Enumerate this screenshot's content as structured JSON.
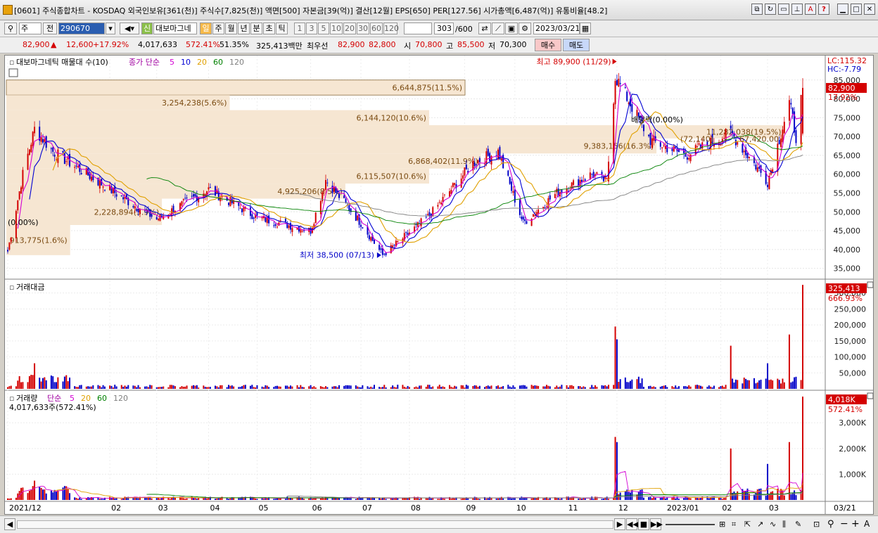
{
  "window": {
    "title": "[0601] 주식종합차트 - KOSDAQ 외국인보유[361(천)] 주식수[7,825(천)] 액면[500] 자본금[39(억)] 결산[12월] EPS[650] PER[127.56] 시가총액[6,487(억)] 유통비율[48.2]",
    "icons": [
      "app-icon",
      "window-link-icon",
      "refresh-icon",
      "window-layout-icon",
      "pin-icon",
      "pen-icon",
      "help-icon",
      "minimize-icon",
      "restore-icon",
      "close-icon"
    ],
    "help_label": "?"
  },
  "toolbar": {
    "period_type": "주",
    "prev_label": "전",
    "stock_code": "290670",
    "indicator_select": "대보마그네",
    "period_buttons": [
      "일",
      "주",
      "월",
      "년",
      "분",
      "초",
      "틱"
    ],
    "active_period": "일",
    "interval_buttons": [
      "1",
      "3",
      "5",
      "10",
      "20",
      "30",
      "60",
      "120"
    ],
    "view_count": "303",
    "view_total": "/600",
    "date": "2023/03/21",
    "new_label": "신"
  },
  "quote": {
    "price": "82,900",
    "change_arrow": "▲",
    "change": "12,600",
    "change_pct": "+17.92%",
    "volume": "4,017,633",
    "volume_pct": "572.41%",
    "ratio": "51.35%",
    "amount": "325,413백만",
    "best_ask_label": "최우선",
    "ask": "82,900",
    "bid": "82,800",
    "open_label": "시",
    "open": "70,800",
    "high_label": "고",
    "high": "85,500",
    "low_label": "저",
    "low": "70,300",
    "buy_label": "매수",
    "sell_label": "매도",
    "colors": {
      "up": "#d40000",
      "down": "#0000c8",
      "buy_bg": "#f9c8c8",
      "sell_bg": "#c8d8f9"
    }
  },
  "price_panel": {
    "legend_title": "대보마그네틱 매물대 수(10)",
    "ma_label": "종가 단순",
    "ma_periods": [
      "5",
      "10",
      "20",
      "60",
      "120"
    ],
    "ma_colors": [
      "#d400d4",
      "#0000d4",
      "#e0a000",
      "#008000",
      "#808080"
    ],
    "lc_label": "LC:115.32",
    "hc_label": "HC:-7.79",
    "last_price_box": "82,900",
    "last_change_label": "17.92%",
    "high_note": "최고 89,900 (11/29)",
    "low_note": "최저 38,500 (07/13)",
    "dividend_note": "배당락(0.00%)",
    "left_note": "(0.00%)",
    "volume_profile": [
      {
        "label": "6,644,875(11.5%)",
        "top": 85000,
        "bottom": 81000,
        "pct": 11.5
      },
      {
        "label": "3,254,238(5.6%)",
        "top": 81000,
        "bottom": 77000,
        "pct": 5.6
      },
      {
        "label": "6,144,120(10.6%)",
        "top": 77000,
        "bottom": 73000,
        "pct": 10.6
      },
      {
        "label": "11,282,038(19.5%)",
        "top": 73000,
        "bottom": 69500,
        "pct": 19.5
      },
      {
        "label": "9,383,156(16.3%)",
        "top": 69500,
        "bottom": 65500,
        "pct": 16.3
      },
      {
        "label": "6,868,402(11.9%)",
        "top": 65500,
        "bottom": 61500,
        "pct": 11.9
      },
      {
        "label": "6,115,507(10.6%)",
        "top": 61500,
        "bottom": 57500,
        "pct": 10.6
      },
      {
        "label": "4,925,206(8.5%)",
        "top": 57500,
        "bottom": 53500,
        "pct": 8.5
      },
      {
        "label": "2,228,894(3.9%)",
        "top": 53500,
        "bottom": 46500,
        "pct": 3.9
      },
      {
        "label": "913,775(1.6%)",
        "top": 46500,
        "bottom": 38500,
        "pct": 1.6
      }
    ],
    "extra_label": "(72,140)",
    "extra_label2": "67,420.00"
  },
  "amount_panel": {
    "legend_title": "거래대금",
    "last_box": "325,413",
    "last_pct": "666.93%"
  },
  "volume_panel": {
    "legend_title": "거래량",
    "ma_label": "단순",
    "ma_periods": [
      "5",
      "20",
      "60",
      "120"
    ],
    "ma_colors": [
      "#d400d4",
      "#e0a000",
      "#008000",
      "#808080"
    ],
    "info": "4,017,633주(572.41%)",
    "last_box": "4,018K",
    "last_pct": "572.41%"
  },
  "xaxis": {
    "labels": [
      "2021/12",
      "02",
      "03",
      "04",
      "05",
      "06",
      "07",
      "08",
      "09",
      "10",
      "11",
      "12",
      "2023/01",
      "02",
      "03"
    ],
    "last_date": "03/21"
  },
  "chart_data": [
    {
      "type": "candlestick",
      "title": "대보마그네틱",
      "x_range": [
        "2021-12-01",
        "2023-03-21"
      ],
      "ylim": [
        32500,
        90000
      ],
      "y_ticks": [
        35000,
        40000,
        45000,
        50000,
        55000,
        60000,
        65000,
        70000,
        75000,
        80000,
        85000
      ],
      "key_points": [
        {
          "date": "2021-12-01",
          "close": 39500
        },
        {
          "date": "2021-12-10",
          "close": 60000
        },
        {
          "date": "2021-12-17",
          "close": 72000
        },
        {
          "date": "2021-12-28",
          "close": 66000
        },
        {
          "date": "2022-02-10",
          "close": 53000
        },
        {
          "date": "2022-02-28",
          "close": 48000
        },
        {
          "date": "2022-03-31",
          "close": 56000
        },
        {
          "date": "2022-04-29",
          "close": 48500
        },
        {
          "date": "2022-05-31",
          "close": 45000
        },
        {
          "date": "2022-06-09",
          "close": 58500
        },
        {
          "date": "2022-06-30",
          "close": 47000
        },
        {
          "date": "2022-07-13",
          "close": 38500
        },
        {
          "date": "2022-08-10",
          "close": 49000
        },
        {
          "date": "2022-09-05",
          "close": 63000
        },
        {
          "date": "2022-09-20",
          "close": 66000
        },
        {
          "date": "2022-10-05",
          "close": 47000
        },
        {
          "date": "2022-10-25",
          "close": 55000
        },
        {
          "date": "2022-11-15",
          "close": 60000
        },
        {
          "date": "2022-11-24",
          "close": 58000
        },
        {
          "date": "2022-11-29",
          "close": 86000
        },
        {
          "date": "2022-12-20",
          "close": 69000
        },
        {
          "date": "2023-01-10",
          "close": 65000
        },
        {
          "date": "2023-02-06",
          "close": 71000
        },
        {
          "date": "2023-02-28",
          "close": 58000
        },
        {
          "date": "2023-03-13",
          "close": 79000
        },
        {
          "date": "2023-03-17",
          "close": 70000
        },
        {
          "date": "2023-03-21",
          "open": 70800,
          "high": 85500,
          "low": 70300,
          "close": 82900
        }
      ]
    },
    {
      "type": "bar",
      "title": "거래대금",
      "ylim": [
        0,
        330000
      ],
      "y_ticks": [
        50000,
        100000,
        150000,
        200000,
        250000,
        300000
      ],
      "tick_labels": [
        "50,000",
        "100,000",
        "150,000",
        "200,000",
        "250,000",
        "300,000"
      ],
      "key_points": [
        {
          "date": "2021-12-17",
          "value": 80000
        },
        {
          "date": "2022-11-29",
          "value": 195000
        },
        {
          "date": "2022-11-30",
          "value": 155000
        },
        {
          "date": "2023-02-06",
          "value": 135000
        },
        {
          "date": "2023-02-28",
          "value": 80000
        },
        {
          "date": "2023-03-13",
          "value": 170000
        },
        {
          "date": "2023-03-21",
          "value": 325413
        }
      ]
    },
    {
      "type": "bar",
      "title": "거래량",
      "ylim": [
        0,
        4100
      ],
      "y_ticks": [
        1000,
        2000,
        3000
      ],
      "tick_labels": [
        "1,000K",
        "2,000K",
        "3,000K"
      ],
      "key_points": [
        {
          "date": "2021-12-17",
          "value": 750
        },
        {
          "date": "2022-11-29",
          "value": 2450
        },
        {
          "date": "2022-11-30",
          "value": 2250
        },
        {
          "date": "2023-02-06",
          "value": 2000
        },
        {
          "date": "2023-02-28",
          "value": 1400
        },
        {
          "date": "2023-03-13",
          "value": 2250
        },
        {
          "date": "2023-03-21",
          "value": 4018
        }
      ]
    }
  ],
  "bottombar": {
    "icons": [
      "scroll-left-icon",
      "scroll-right-icon",
      "play-icon",
      "step-back-icon",
      "stop-icon",
      "fast-forward-icon",
      "zoom-slider-icon",
      "crosshair-icon",
      "line-tool-icon",
      "zoom-icon",
      "minus-icon",
      "plus-icon",
      "auto-icon"
    ],
    "auto_label": "A"
  }
}
